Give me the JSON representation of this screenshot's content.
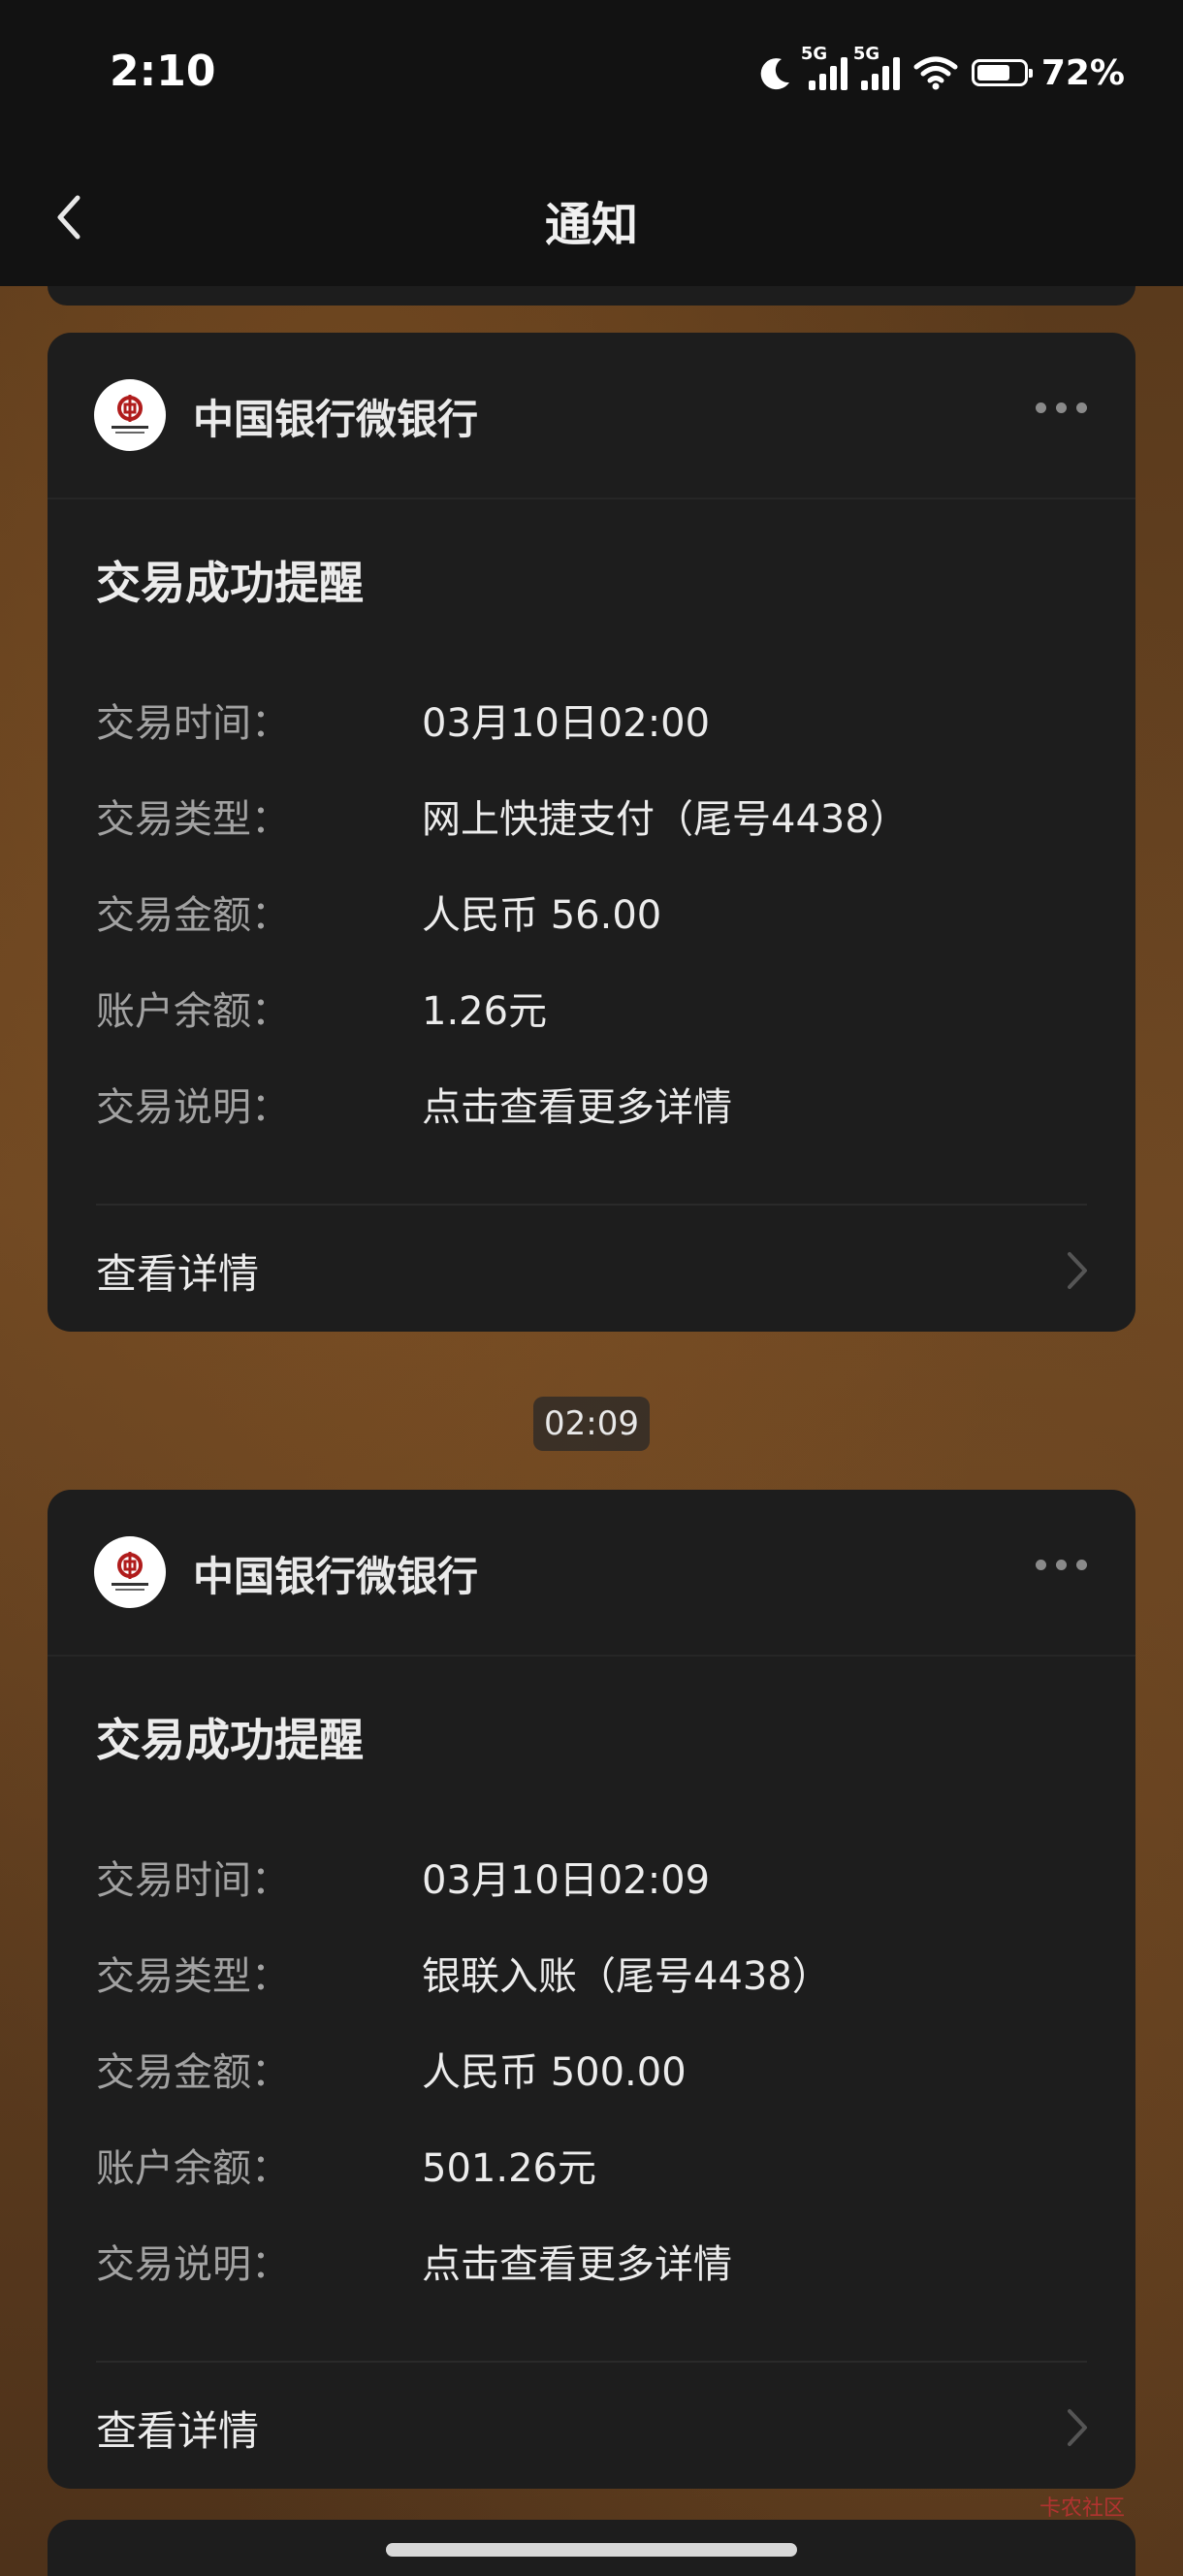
{
  "status_bar": {
    "time": "2:10",
    "battery": "72%",
    "battery_level": 0.72,
    "network_1": "5G",
    "network_2": "5G"
  },
  "nav": {
    "title": "通知"
  },
  "notifications": [
    {
      "sender": "中国银行微银行",
      "title": "交易成功提醒",
      "rows": [
        {
          "label": "交易时间：",
          "value": "03月10日02:00"
        },
        {
          "label": "交易类型：",
          "value": "网上快捷支付（尾号4438）"
        },
        {
          "label": "交易金额：",
          "value": "人民币 56.00"
        },
        {
          "label": "账户余额：",
          "value": "1.26元"
        },
        {
          "label": "交易说明：",
          "value": "点击查看更多详情"
        }
      ],
      "detail_link": "查看详情"
    },
    {
      "sender": "中国银行微银行",
      "title": "交易成功提醒",
      "rows": [
        {
          "label": "交易时间：",
          "value": "03月10日02:09"
        },
        {
          "label": "交易类型：",
          "value": "银联入账（尾号4438）"
        },
        {
          "label": "交易金额：",
          "value": "人民币 500.00"
        },
        {
          "label": "账户余额：",
          "value": "501.26元"
        },
        {
          "label": "交易说明：",
          "value": "点击查看更多详情"
        }
      ],
      "detail_link": "查看详情"
    }
  ],
  "separator_time": "02:09",
  "watermark": "卡农社区"
}
